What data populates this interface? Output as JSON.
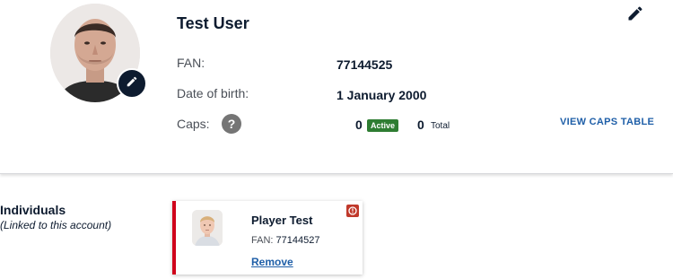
{
  "profile": {
    "name": "Test User",
    "fan_label": "FAN:",
    "fan_value": "77144525",
    "dob_label": "Date of birth:",
    "dob_value": "1 January 2000",
    "caps_label": "Caps:",
    "caps_help": "?",
    "caps_active": "0",
    "caps_active_badge": "Active",
    "caps_total": "0",
    "caps_total_label": "Total",
    "view_caps_link": "VIEW CAPS TABLE"
  },
  "individuals": {
    "title": "Individuals",
    "subtitle": "(Linked to this account)",
    "cards": [
      {
        "name": "Player Test",
        "fan_label": "FAN:",
        "fan_value": "77144527",
        "remove_label": "Remove"
      }
    ]
  },
  "icons": {
    "edit": "pencil-icon",
    "help": "question-icon",
    "warning": "alert-icon"
  },
  "colors": {
    "navy": "#0d1b2f",
    "link_blue": "#1f5fa8",
    "active_green": "#2e7d32",
    "alert_red": "#d0021b"
  }
}
